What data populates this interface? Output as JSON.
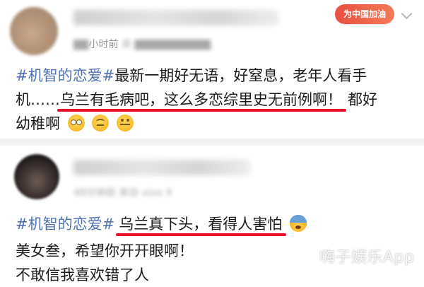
{
  "post1": {
    "time": "小时前",
    "device": "来",
    "badge": "为中国加油",
    "line1_tag": "#机智的恋爱#",
    "line1_rest": "最新一期好无语，好窒息，老年人看手",
    "line2_a": "机……",
    "line2_ul": "乌兰有毛病吧，这么多恋综里史无前例啊！",
    "line2_b": "都好",
    "line3": "幼稚啊",
    "emojis": [
      "eyes-emoji",
      "upside-down-emoji",
      "zipper-mouth-emoji"
    ]
  },
  "post2": {
    "time": "48分钟前",
    "device": "来自 vivo X",
    "tag": "#机智的恋爱#",
    "ul": "乌兰真下头，看得人害怕",
    "line2": "美女叁，希望你开开眼啊！",
    "line3": "不敢信我喜欢错了人",
    "emoji": "fearful-emoji"
  },
  "watermark": "嗨子娱乐App",
  "colors": {
    "tag": "#4f73b2",
    "underline": "#e8102c",
    "badge": "#e94f43"
  }
}
